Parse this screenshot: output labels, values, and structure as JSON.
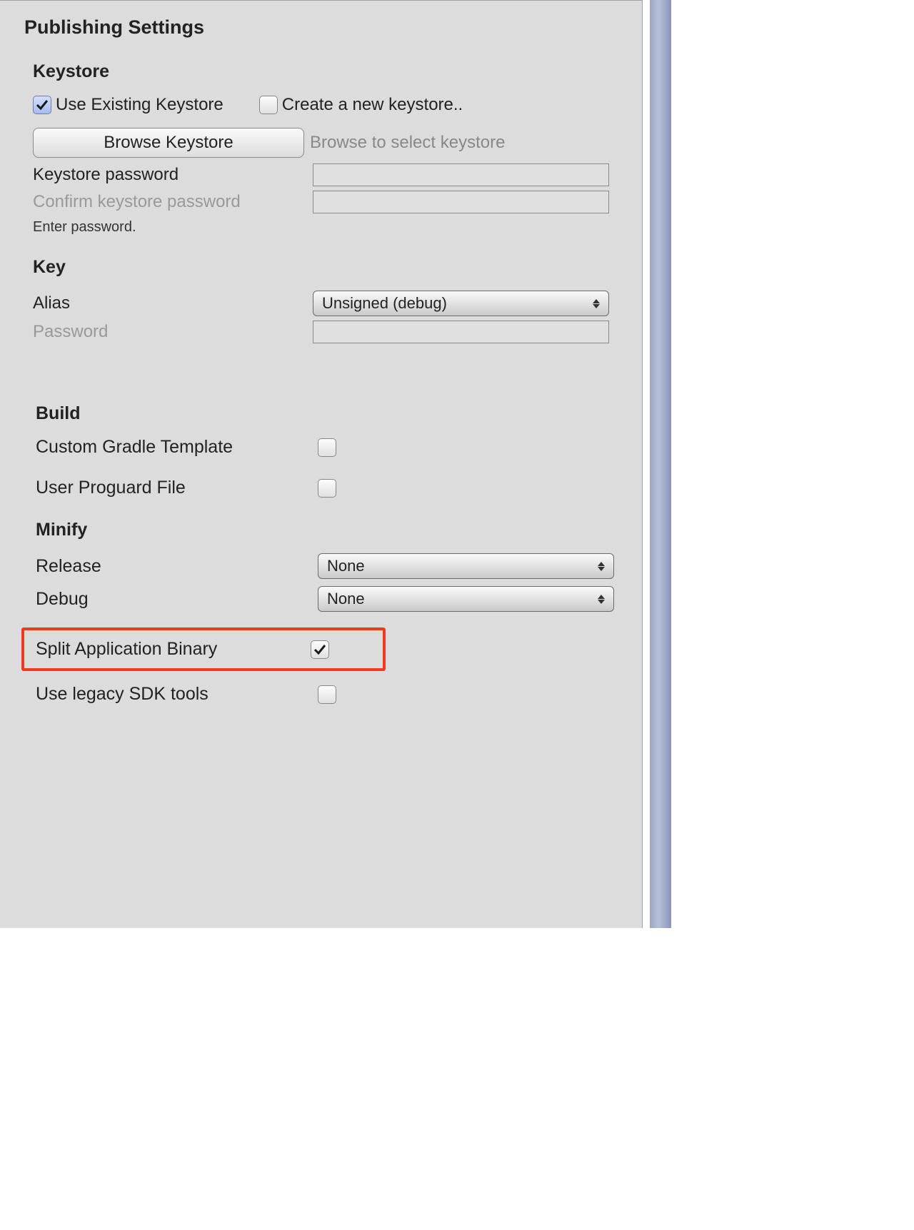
{
  "panel": {
    "title": "Publishing Settings"
  },
  "keystore": {
    "heading": "Keystore",
    "use_existing_label": "Use Existing Keystore",
    "create_new_label": "Create a new keystore..",
    "browse_button": "Browse Keystore",
    "browse_hint": "Browse to select keystore",
    "password_label": "Keystore password",
    "confirm_password_label": "Confirm keystore password",
    "enter_hint": "Enter password."
  },
  "key": {
    "heading": "Key",
    "alias_label": "Alias",
    "alias_value": "Unsigned (debug)",
    "password_label": "Password"
  },
  "build": {
    "heading": "Build",
    "gradle_label": "Custom Gradle Template",
    "proguard_label": "User Proguard File"
  },
  "minify": {
    "heading": "Minify",
    "release_label": "Release",
    "release_value": "None",
    "debug_label": "Debug",
    "debug_value": "None"
  },
  "footer": {
    "split_label": "Split Application Binary",
    "legacy_label": "Use legacy SDK tools"
  }
}
